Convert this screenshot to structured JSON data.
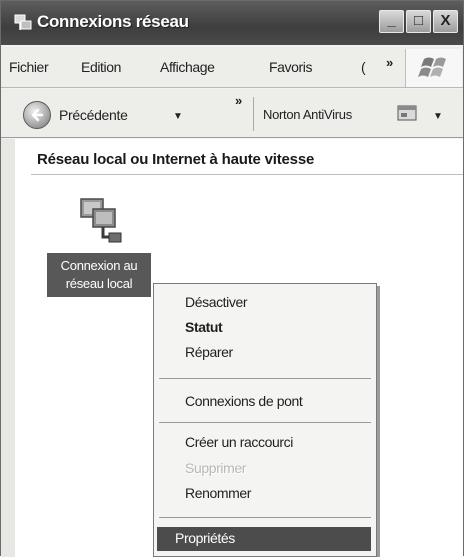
{
  "window": {
    "title": "Connexions réseau",
    "buttons": {
      "minimize": "_",
      "maximize": "□",
      "close": "X"
    }
  },
  "menubar": {
    "items": [
      "Fichier",
      "Edition",
      "Affichage",
      "Favoris",
      "("
    ],
    "overflow": "»"
  },
  "toolbar": {
    "back_label": "Précédente",
    "back_dropdown": "▼",
    "overflow": "»",
    "norton_label": "Norton AntiVirus",
    "norton_dropdown": "▼"
  },
  "content": {
    "group_heading": "Réseau local ou Internet à haute vitesse",
    "connection": {
      "line1": "Connexion au",
      "line2": "réseau local"
    }
  },
  "context_menu": {
    "items": [
      {
        "label": "Désactiver",
        "state": "normal"
      },
      {
        "label": "Statut",
        "state": "bold"
      },
      {
        "label": "Réparer",
        "state": "normal"
      },
      {
        "label": "Connexions de pont",
        "state": "normal"
      },
      {
        "label": "Créer un raccourci",
        "state": "normal"
      },
      {
        "label": "Supprimer",
        "state": "disabled"
      },
      {
        "label": "Renommer",
        "state": "normal"
      },
      {
        "label": "Propriétés",
        "state": "highlighted"
      }
    ]
  }
}
